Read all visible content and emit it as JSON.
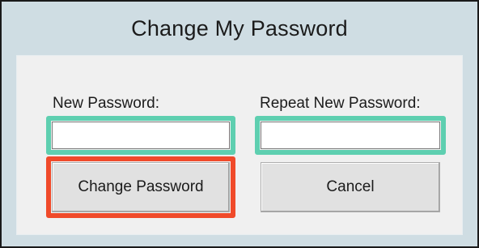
{
  "dialog": {
    "title": "Change My Password"
  },
  "form": {
    "new_password_label": "New Password:",
    "new_password_value": "",
    "repeat_password_label": "Repeat New Password:",
    "repeat_password_value": ""
  },
  "buttons": {
    "change_password_label": "Change Password",
    "cancel_label": "Cancel"
  },
  "highlights": {
    "input_highlight_color": "#5ecfb0",
    "primary_button_highlight_color": "#f04a2a"
  }
}
